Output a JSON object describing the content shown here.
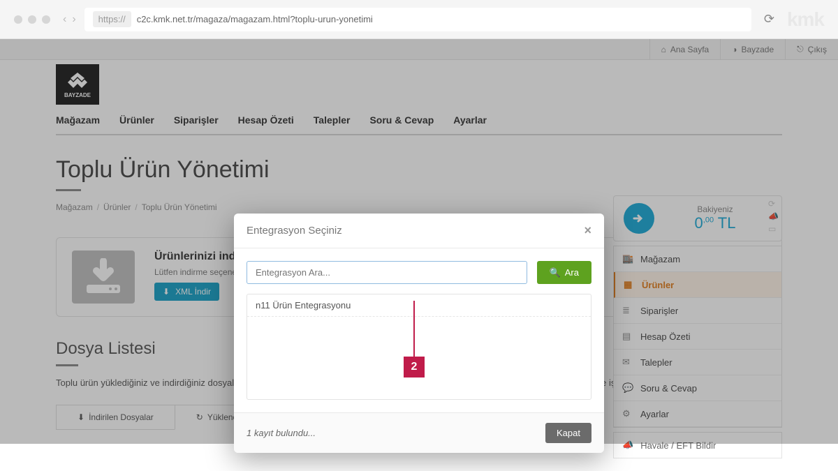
{
  "url": {
    "protocol": "https://",
    "rest": "c2c.kmk.net.tr/magaza/magazam.html?toplu-urun-yonetimi"
  },
  "brand_kmk": "kmk",
  "topbar": {
    "home": "Ana Sayfa",
    "user": "Bayzade",
    "logout": "Çıkış"
  },
  "logo_text": "BAYZADE",
  "mainnav": [
    "Mağazam",
    "Ürünler",
    "Siparişler",
    "Hesap Özeti",
    "Talepler",
    "Soru & Cevap",
    "Ayarlar"
  ],
  "page_title": "Toplu Ürün Yönetimi",
  "breadcrumb": [
    "Mağazam",
    "Ürünler",
    "Toplu Ürün Yönetimi"
  ],
  "card": {
    "title": "Ürünlerinizi indirebilirsiniz",
    "desc": "Lütfen indirme seçeneklerinden birini seçerek ürün listenizin formatını belirleyin.",
    "xml_btn": "XML İndir"
  },
  "section": {
    "title": "Dosya Listesi",
    "desc": "Toplu ürün yüklediğiniz ve indirdiğiniz dosyaları burada görebilirsiniz. Dosyaların işlenme durumunu görmek için sayfayı güncelleyebilir ve işlemleri inceleyebilirsiniz."
  },
  "tabs": {
    "downloaded": "İndirilen Dosyalar",
    "uploaded": "Yüklenen Dosyalar"
  },
  "balance": {
    "label": "Bakiyeniz",
    "int": "0",
    "dec": ",00",
    "cur": " TL"
  },
  "sidemenu": [
    {
      "icon": "🏬",
      "label": "Mağazam"
    },
    {
      "icon": "▦",
      "label": "Ürünler",
      "active": true
    },
    {
      "icon": "≣",
      "label": "Siparişler"
    },
    {
      "icon": "▤",
      "label": "Hesap Özeti"
    },
    {
      "icon": "✉",
      "label": "Talepler"
    },
    {
      "icon": "💬",
      "label": "Soru & Cevap"
    },
    {
      "icon": "⚙",
      "label": "Ayarlar"
    }
  ],
  "havale": "Havale / EFT Bildir",
  "modal": {
    "title": "Entegrasyon Seçiniz",
    "placeholder": "Entegrasyon Ara...",
    "ara": "Ara",
    "results": [
      "n11 Ürün Entegrasyonu"
    ],
    "count_text": "1 kayıt bulundu...",
    "close": "Kapat"
  },
  "callout_number": "2"
}
